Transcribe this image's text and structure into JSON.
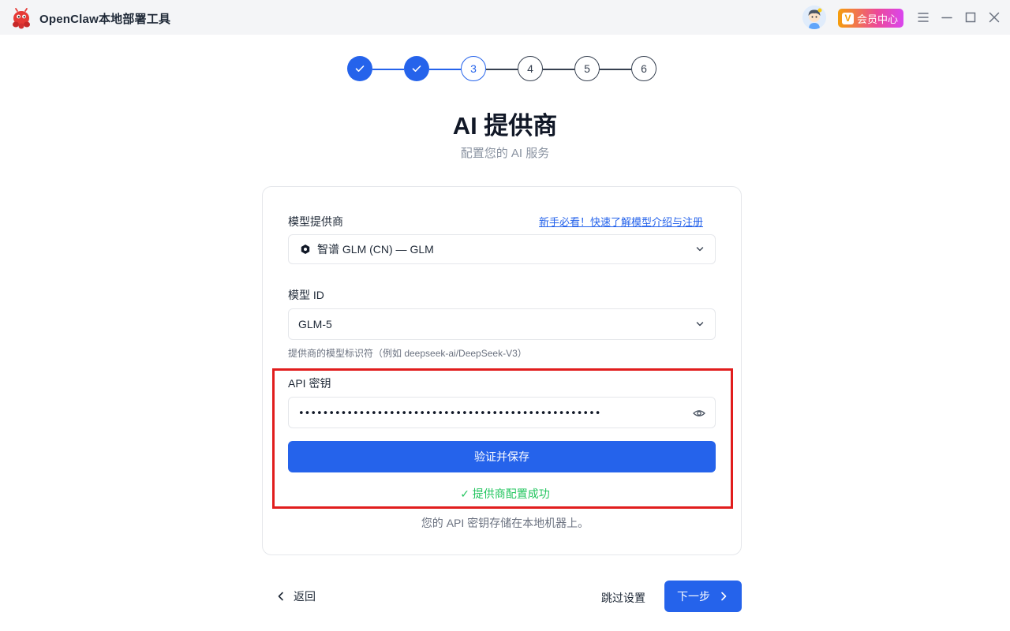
{
  "titlebar": {
    "app_title": "OpenClaw本地部署工具",
    "vip_label": "会员中心",
    "vip_badge_letter": "V"
  },
  "stepper": {
    "steps": [
      {
        "label": "",
        "state": "done"
      },
      {
        "label": "",
        "state": "done"
      },
      {
        "label": "3",
        "state": "current"
      },
      {
        "label": "4",
        "state": "todo"
      },
      {
        "label": "5",
        "state": "todo"
      },
      {
        "label": "6",
        "state": "todo"
      }
    ]
  },
  "header": {
    "title": "AI 提供商",
    "subtitle": "配置您的 AI 服务"
  },
  "form": {
    "provider_label": "模型提供商",
    "help_link": "新手必看！快速了解模型介绍与注册",
    "provider_value": "智谱 GLM (CN) — GLM",
    "model_label": "模型 ID",
    "model_value": "GLM-5",
    "model_hint": "提供商的模型标识符（例如 deepseek-ai/DeepSeek-V3）",
    "api_key_label": "API 密钥",
    "api_key_value": "••••••••••••••••••••••••••••••••••••••••••••••••••",
    "verify_button": "验证并保存",
    "success_message": "✓ 提供商配置成功",
    "storage_note": "您的 API 密钥存储在本地机器上。"
  },
  "footer_nav": {
    "back_label": "返回",
    "skip_label": "跳过设置",
    "next_label": "下一步"
  },
  "colors": {
    "accent": "#2563eb",
    "success": "#22c55e",
    "highlight": "#e11d1d"
  }
}
